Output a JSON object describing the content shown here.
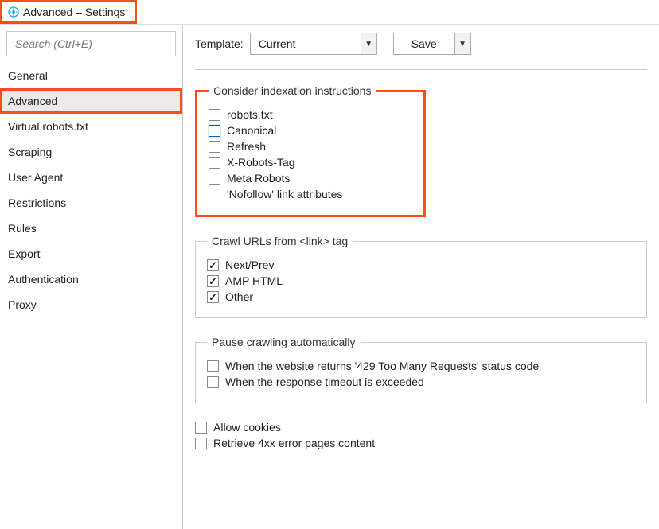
{
  "window": {
    "title": "Advanced – Settings"
  },
  "sidebar": {
    "search_placeholder": "Search (Ctrl+E)",
    "items": [
      {
        "label": "General"
      },
      {
        "label": "Advanced"
      },
      {
        "label": "Virtual robots.txt"
      },
      {
        "label": "Scraping"
      },
      {
        "label": "User Agent"
      },
      {
        "label": "Restrictions"
      },
      {
        "label": "Rules"
      },
      {
        "label": "Export"
      },
      {
        "label": "Authentication"
      },
      {
        "label": "Proxy"
      }
    ]
  },
  "toolbar": {
    "template_label": "Template:",
    "template_value": "Current",
    "save_label": "Save"
  },
  "groups": {
    "indexation": {
      "legend": "Consider indexation instructions",
      "items": [
        {
          "label": "robots.txt"
        },
        {
          "label": "Canonical"
        },
        {
          "label": "Refresh"
        },
        {
          "label": "X-Robots-Tag"
        },
        {
          "label": "Meta Robots"
        },
        {
          "label": "'Nofollow' link attributes"
        }
      ]
    },
    "link_tag": {
      "legend": "Crawl URLs from <link> tag",
      "items": [
        {
          "label": "Next/Prev"
        },
        {
          "label": "AMP HTML"
        },
        {
          "label": "Other"
        }
      ]
    },
    "pause": {
      "legend": "Pause crawling automatically",
      "items": [
        {
          "label": "When the website returns '429 Too Many Requests' status code"
        },
        {
          "label": "When the response timeout is exceeded"
        }
      ]
    }
  },
  "loose": {
    "allow_cookies": "Allow cookies",
    "retrieve_4xx": "Retrieve 4xx error pages content"
  }
}
